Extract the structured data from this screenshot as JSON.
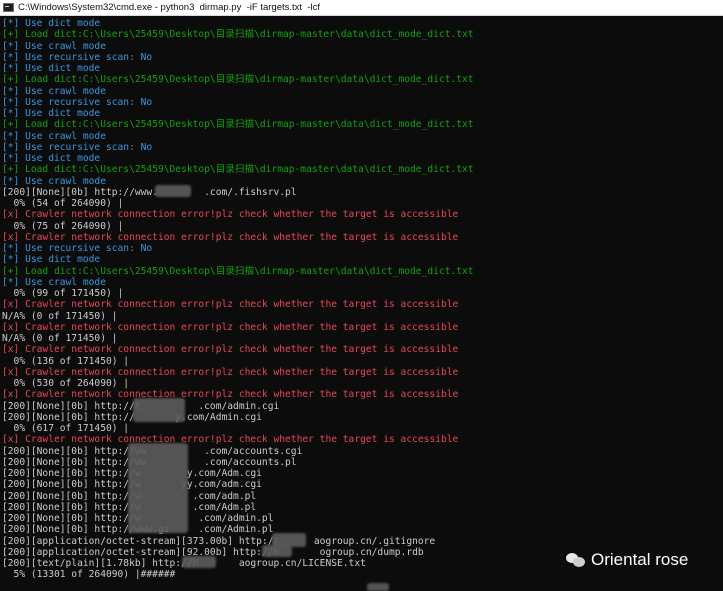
{
  "window": {
    "title": "C:\\Windows\\System32\\cmd.exe - python3  dirmap.py  -iF targets.txt  -lcf"
  },
  "console": {
    "lines": [
      {
        "t": "[*] Use dict mode",
        "k": "c"
      },
      {
        "t": "[+] Load dict:C:\\Users\\25459\\Desktop\\目录扫描\\dirmap-master\\data\\dict_mode_dict.txt",
        "k": "g"
      },
      {
        "t": "[*] Use crawl mode",
        "k": "c"
      },
      {
        "t": "[*] Use recursive scan: No",
        "k": "c"
      },
      {
        "t": "[*] Use dict mode",
        "k": "c"
      },
      {
        "t": "[+] Load dict:C:\\Users\\25459\\Desktop\\目录扫描\\dirmap-master\\data\\dict_mode_dict.txt",
        "k": "g"
      },
      {
        "t": "[*] Use crawl mode",
        "k": "c"
      },
      {
        "t": "[*] Use recursive scan: No",
        "k": "c"
      },
      {
        "t": "[*] Use dict mode",
        "k": "c"
      },
      {
        "t": "[+] Load dict:C:\\Users\\25459\\Desktop\\目录扫描\\dirmap-master\\data\\dict_mode_dict.txt",
        "k": "g"
      },
      {
        "t": "[*] Use crawl mode",
        "k": "c"
      },
      {
        "t": "[*] Use recursive scan: No",
        "k": "c"
      },
      {
        "t": "[*] Use dict mode",
        "k": "c"
      },
      {
        "t": "[+] Load dict:C:\\Users\\25459\\Desktop\\目录扫描\\dirmap-master\\data\\dict_mode_dict.txt",
        "k": "g"
      },
      {
        "t": "[*] Use crawl mode",
        "k": "c"
      },
      {
        "t": "[200][None][0b] http://www.        .com/.fishsrv.pl",
        "k": "w"
      },
      {
        "t": "  0% (54 of 264090) |",
        "k": "w"
      },
      {
        "t": "[x] Crawler network connection error!plz check whether the target is accessible",
        "k": "r"
      },
      {
        "t": "  0% (75 of 264090) |",
        "k": "w"
      },
      {
        "t": "[x] Crawler network connection error!plz check whether the target is accessible",
        "k": "r"
      },
      {
        "t": "[*] Use recursive scan: No",
        "k": "c"
      },
      {
        "t": "[*] Use dict mode",
        "k": "c"
      },
      {
        "t": "[+] Load dict:C:\\Users\\25459\\Desktop\\目录扫描\\dirmap-master\\data\\dict_mode_dict.txt",
        "k": "g"
      },
      {
        "t": "[*] Use crawl mode",
        "k": "c"
      },
      {
        "t": "  0% (99 of 171450) |",
        "k": "w"
      },
      {
        "t": "[x] Crawler network connection error!plz check whether the target is accessible",
        "k": "r"
      },
      {
        "t": "N/A% (0 of 171450) |",
        "k": "w"
      },
      {
        "t": "[x] Crawler network connection error!plz check whether the target is accessible",
        "k": "r"
      },
      {
        "t": "N/A% (0 of 171450) |",
        "k": "w"
      },
      {
        "t": "[x] Crawler network connection error!plz check whether the target is accessible",
        "k": "r"
      },
      {
        "t": "  0% (136 of 171450) |",
        "k": "w"
      },
      {
        "t": "[x] Crawler network connection error!plz check whether the target is accessible",
        "k": "r"
      },
      {
        "t": "  0% (530 of 264090) |",
        "k": "w"
      },
      {
        "t": "[x] Crawler network connection error!plz check whether the target is accessible",
        "k": "r"
      },
      {
        "t": "[200][None][0b] http://t          .com/admin.cgi",
        "k": "w"
      },
      {
        "t": "[200][None][0b] http://       y.com/Admin.cgi",
        "k": "w"
      },
      {
        "t": "  0% (617 of 171450) |",
        "k": "w"
      },
      {
        "t": "[x] Crawler network connection error!plz check whether the target is accessible",
        "k": "r"
      },
      {
        "t": "[200][None][0b] http://ww          .com/accounts.cgi",
        "k": "w"
      },
      {
        "t": "[200][None][0b] http://ww          .com/accounts.pl",
        "k": "w"
      },
      {
        "t": "[200][None][0b] http://w        y.com/Adm.cgi",
        "k": "w"
      },
      {
        "t": "[200][None][0b] http://w       yy.com/adm.cgi",
        "k": "w"
      },
      {
        "t": "[200][None][0b] http://w         .com/adm.pl",
        "k": "w"
      },
      {
        "t": "[200][None][0b] http://w         .com/Adm.pl",
        "k": "w"
      },
      {
        "t": "[200][None][0b] http://w          .com/admin.pl",
        "k": "w"
      },
      {
        "t": "[200][None][0b] http://www.gz     .com/Admin.pl",
        "k": "w"
      },
      {
        "t": "[200][application/octet-stream][373.00b] http://      aogroup.cn/.gitignore",
        "k": "w"
      },
      {
        "t": "[200][application/octet-stream][92.00b] http://h       ogroup.cn/dump.rdb",
        "k": "w"
      },
      {
        "t": "[200][text/plain][1.78kb] http://h       aogroup.cn/LICENSE.txt",
        "k": "w"
      },
      {
        "t": "  5% (13301 of 264090) |######",
        "k": "w"
      }
    ]
  },
  "watermark": {
    "icon": "wechat-icon",
    "text": "Oriental rose"
  }
}
